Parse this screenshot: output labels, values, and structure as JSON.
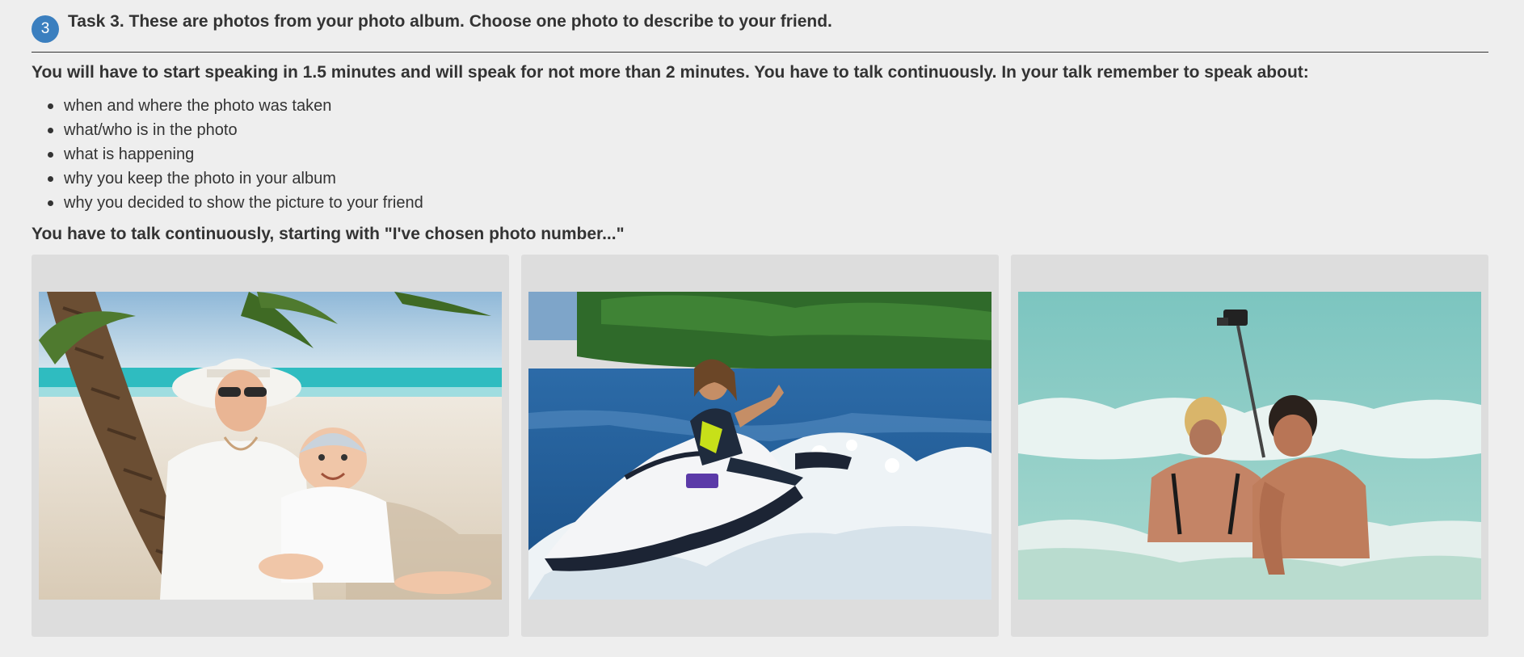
{
  "task": {
    "number": "3",
    "title": "Task 3. These are photos from your photo album. Choose one photo to describe to your friend."
  },
  "instructions": "You will have to start speaking in 1.5 minutes and will speak for not more than 2 minutes. You have to talk continuously. In your talk remember to speak about:",
  "points": [
    "when and where the photo was taken",
    "what/who is in the photo",
    "what is happening",
    "why you keep the photo in your album",
    "why you decided to show the picture to your friend"
  ],
  "closing": "You have to talk continuously, starting with \"I've chosen photo number...\"",
  "colors": {
    "badge": "#3b7fbf",
    "background": "#eeeeee",
    "card": "#dddddd",
    "text": "#333333"
  }
}
